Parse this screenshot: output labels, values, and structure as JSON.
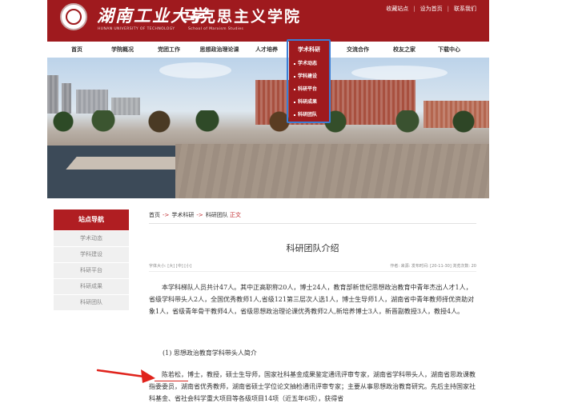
{
  "header": {
    "uni_name": "湖南工业大学",
    "uni_en": "HUNAN UNIVERSITY OF TECHNOLOGY",
    "school_name": "马克思主义学院",
    "school_en": "School of Marxism Studies",
    "toplinks": [
      "收藏站点",
      "设为首页",
      "联系我们"
    ]
  },
  "nav": {
    "items": [
      "首页",
      "学院概况",
      "党团工作",
      "思想政治理论课",
      "人才培养",
      "学术科研",
      "交流合作",
      "校友之家",
      "下载中心"
    ],
    "active": "学术科研"
  },
  "dropdown": {
    "items": [
      "学术动态",
      "学科建设",
      "科研平台",
      "科研成果",
      "科研团队"
    ]
  },
  "sidebar": {
    "title": "站点导航",
    "items": [
      "学术动态",
      "学科建设",
      "科研平台",
      "科研成果",
      "科研团队"
    ]
  },
  "breadcrumb": {
    "home": "首页",
    "sep": "->",
    "level1": "学术科研",
    "level2": "科研团队",
    "current": "正文"
  },
  "article": {
    "title": "科研团队介绍",
    "font_size_label": "字体大小: [大] [中] [小]",
    "meta_right": "作者:    来源:    发布时间: [20-11-30]    浏览次数: 20",
    "para1": "本学科梯队人员共计47人。其中正高职称20人，博士24人，教育部新世纪思想政治教育中青年杰出人才1人，省级学科带头人2人，全国优秀教师1人,省级121第三层次人选1人，博士生导师1人，湖南省中青年教师择优资助对象1人，省级青年骨干教师4人，省级思想政治理论课优秀教师2人,新培养博士3人，新晋副教授3人，教授4人。",
    "heading2": "(1) 思想政治教育学科带头人简介",
    "para2": "陈若松，博士，教授，硕士生导师，国家社科基金成果鉴定通讯评审专家，湖南省学科带头人，湖南省思政课教指委委员，湖南省优秀教师，湖南省硕士学位论文抽检通讯评审专家；主要从事思想政治教育研究。先后主持国家社科基金、省社会科学重大项目等各级项目14项（近五年6项），获得省"
  }
}
